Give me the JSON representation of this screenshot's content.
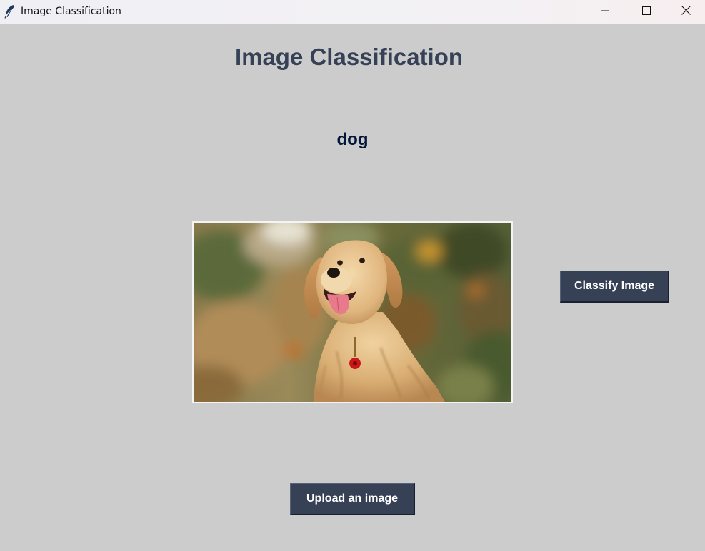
{
  "window": {
    "title": "Image Classification",
    "icon": "feather-icon",
    "controls": {
      "minimize": "minimize-icon",
      "maximize": "maximize-icon",
      "close": "close-icon"
    }
  },
  "main": {
    "heading": "Image Classification",
    "result": "dog",
    "image": {
      "subject": "golden retriever photo"
    },
    "classify_button": "Classify Image",
    "upload_button": "Upload an image"
  },
  "colors": {
    "background": "#cccccc",
    "heading": "#364156",
    "result": "#011638",
    "button": "#364156",
    "button_text": "#ffffff"
  }
}
